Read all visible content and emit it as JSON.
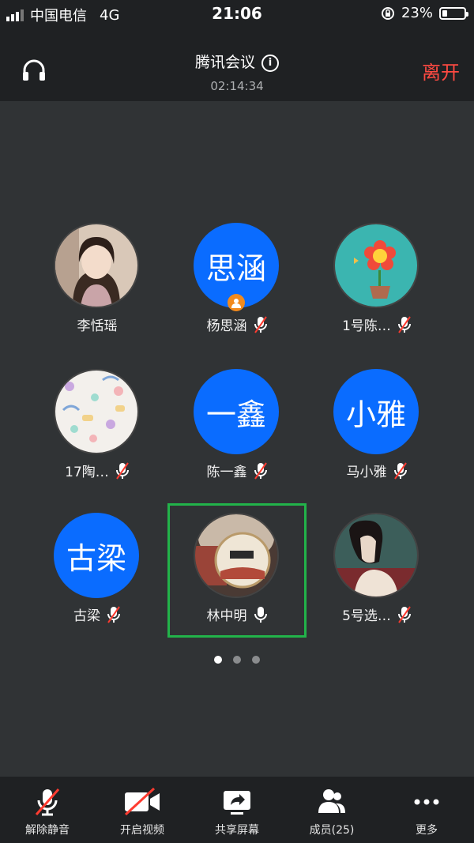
{
  "status": {
    "carrier": "中国电信",
    "network": "4G",
    "time": "21:06",
    "battery": "23%",
    "battery_level": 0.23
  },
  "header": {
    "title": "腾讯会议",
    "timer": "02:14:34",
    "leave_label": "离开"
  },
  "participants": [
    {
      "name": "李恬瑶",
      "avatar_text": "",
      "muted": null,
      "avatar_kind": "photo-girl"
    },
    {
      "name": "杨思涵",
      "avatar_text": "思涵",
      "muted": true,
      "host": true
    },
    {
      "name": "1号陈…",
      "avatar_text": "",
      "muted": true,
      "avatar_kind": "flower"
    },
    {
      "name": "17陶…",
      "avatar_text": "",
      "muted": true,
      "avatar_kind": "pattern"
    },
    {
      "name": "陈一鑫",
      "avatar_text": "一鑫",
      "muted": true
    },
    {
      "name": "马小雅",
      "avatar_text": "小雅",
      "muted": true
    },
    {
      "name": "古梁",
      "avatar_text": "古梁",
      "muted": true
    },
    {
      "name": "林中明",
      "avatar_text": "",
      "muted": false,
      "speaking": true,
      "avatar_kind": "tin"
    },
    {
      "name": "5号选…",
      "avatar_text": "",
      "muted": true,
      "avatar_kind": "illustration"
    }
  ],
  "pagination": {
    "pages": 3,
    "current": 1
  },
  "toolbar": {
    "unmute": "解除静音",
    "video": "开启视频",
    "share": "共享屏幕",
    "members": "成员(25)",
    "more": "更多"
  },
  "colors": {
    "accent_blue": "#0a6cff",
    "leave_red": "#ff4a42",
    "speaking_green": "#22b34a",
    "host_orange": "#f28a1d"
  }
}
